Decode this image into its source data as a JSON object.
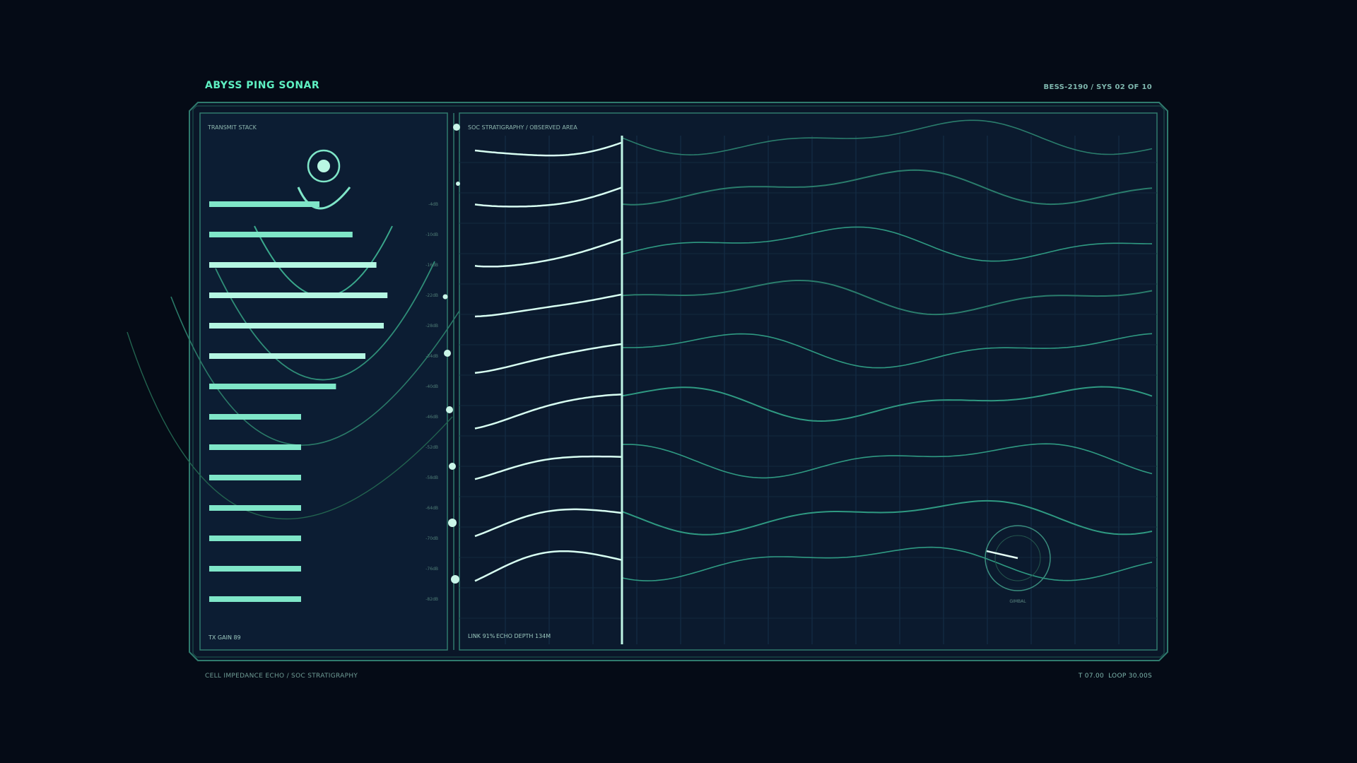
{
  "header": {
    "app_title": "ABYSS PING SONAR",
    "system_id": "BESS-2190 / SYS 02 OF 10"
  },
  "transmit_panel": {
    "title": "TRANSMIT STACK",
    "bar_levels": [
      0.6,
      0.78,
      0.91,
      0.97,
      0.95,
      0.85,
      0.69,
      0.5,
      0.5,
      0.5,
      0.5,
      0.5,
      0.5,
      0.5
    ],
    "gain_label": "TX GAIN 89"
  },
  "depth_scale": {
    "labels": [
      "-4dB",
      "-10dB",
      "-16dB",
      "-22dB",
      "-28dB",
      "-34dB",
      "-40dB",
      "-46dB",
      "-52dB",
      "-58dB",
      "-64dB",
      "-70dB",
      "-76dB",
      "-82dB"
    ]
  },
  "stratigraphy_panel": {
    "title": "SOC STRATIGRAPHY / OBSERVED AREA",
    "link_label": "LINK 91%",
    "echo_label": "ECHO DEPTH 134M",
    "gimbal_label": "GIMBAL"
  },
  "footer": {
    "left": "CELL IMPEDANCE ECHO / SOC STRATIGRAPHY",
    "time": "T 07.00",
    "loop": "LOOP 30.00S"
  },
  "colors": {
    "accent": "#5ef0c2",
    "bar": "#7fe6c8",
    "panel": "#0b1a2e",
    "frame": "#2f7a6d",
    "trace_bright": "#d8fff2",
    "trace_dim": "#2f9a82"
  }
}
